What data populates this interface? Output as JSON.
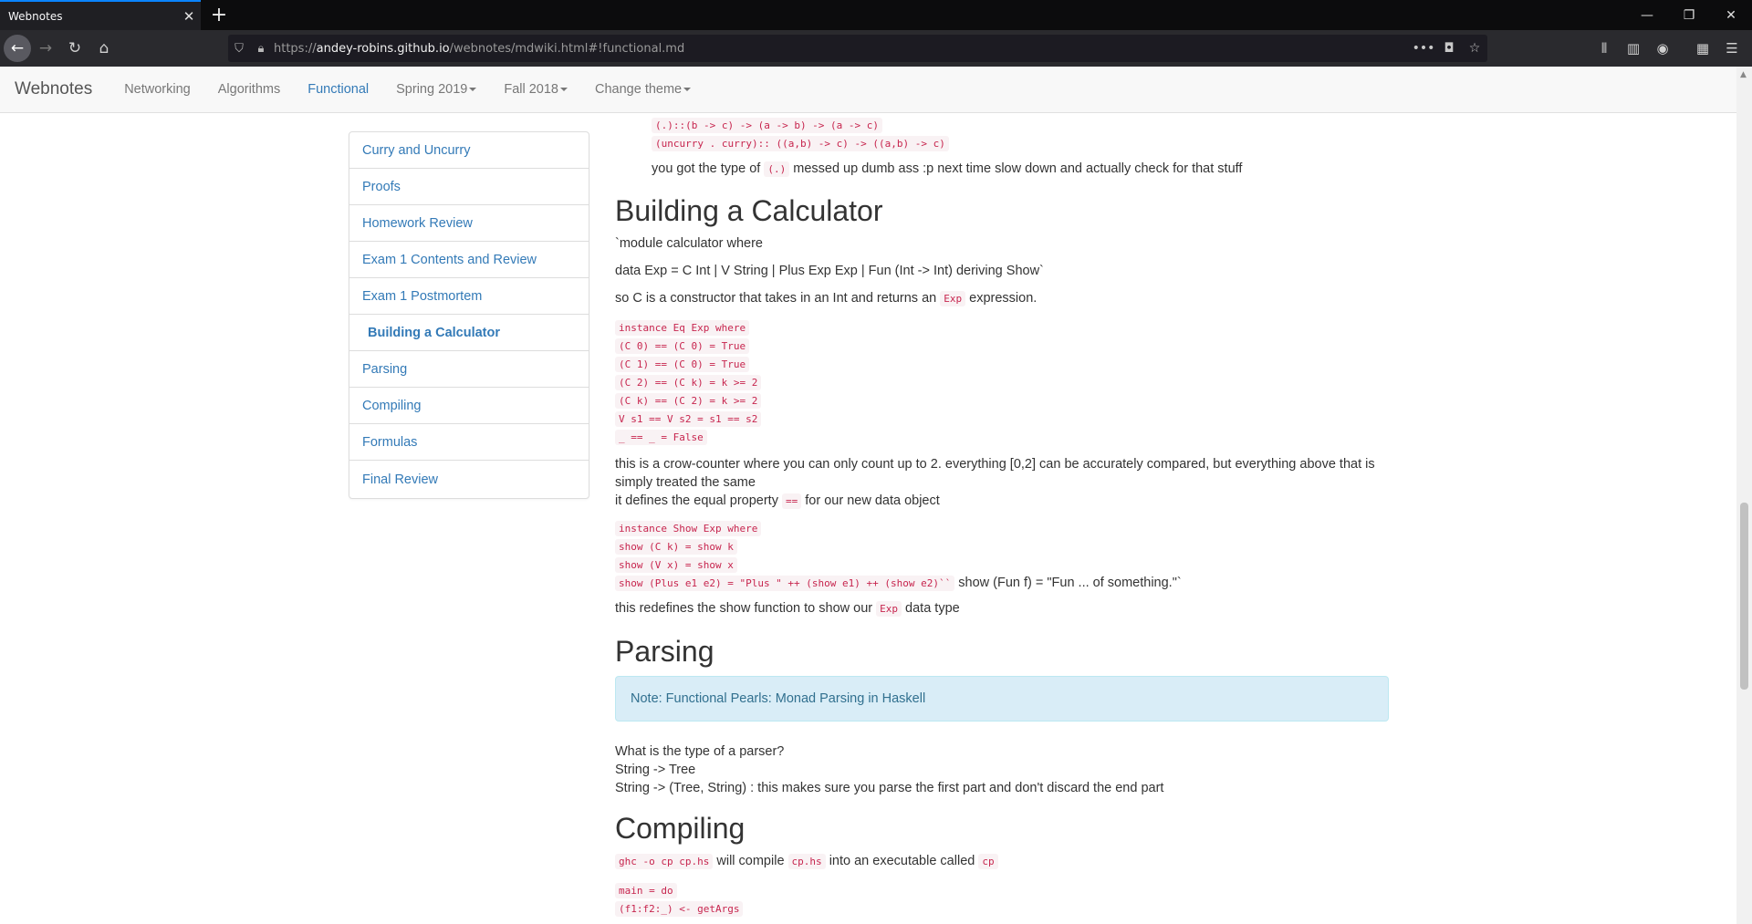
{
  "browser": {
    "tab_title": "Webnotes",
    "url_prefix": "https://",
    "url_host": "andey-robins.github.io",
    "url_path": "/webnotes/mdwiki.html#!functional.md"
  },
  "navbar": {
    "brand": "Webnotes",
    "links": [
      {
        "label": "Networking"
      },
      {
        "label": "Algorithms"
      },
      {
        "label": "Functional"
      },
      {
        "label": "Spring 2019"
      },
      {
        "label": "Fall 2018"
      },
      {
        "label": "Change theme"
      }
    ]
  },
  "sidebar": {
    "items": [
      {
        "label": "Curry and Uncurry"
      },
      {
        "label": "Proofs"
      },
      {
        "label": "Homework Review"
      },
      {
        "label": "Exam 1 Contents and Review"
      },
      {
        "label": "Exam 1 Postmortem"
      },
      {
        "label": "Building a Calculator"
      },
      {
        "label": "Parsing"
      },
      {
        "label": "Compiling"
      },
      {
        "label": "Formulas"
      },
      {
        "label": "Final Review"
      }
    ]
  },
  "content": {
    "top_code": [
      "(.)::(b -> c) -> (a -> b) -> (a -> c)",
      "(uncurry . curry):: ((a,b) -> c) -> ((a,b) -> c)"
    ],
    "top_note": {
      "pre": "you got the type of",
      "code": "(.)",
      "post": "messed up dumb ass :p next time slow down and actually check for that stuff"
    },
    "calc": {
      "heading": "Building a Calculator",
      "p1": "`module calculator where",
      "p2": "data Exp = C Int | V String | Plus Exp Exp | Fun (Int -> Int) deriving Show`",
      "p3": {
        "pre": "so C is a constructor that takes in an Int and returns an",
        "code": "Exp",
        "post": "expression."
      },
      "eq_code": [
        "instance Eq Exp where",
        "(C 0) == (C 0) = True",
        "(C 1) == (C 0) = True",
        "(C 2) == (C k) = k >= 2",
        "(C k) == (C 2) = k >= 2",
        "V s1 == V s2 = s1 == s2",
        "_ == _ = False"
      ],
      "p4_line1": "this is a crow-counter where you can only count up to 2. everything [0,2] can be accurately compared, but everything above that is",
      "p4_line2": "simply treated the same",
      "p5": {
        "pre": "it defines the equal property",
        "code": "==",
        "post": "for our new data object"
      },
      "show_code": [
        "instance Show Exp where",
        "show (C k) = show k",
        "show (V x) = show x",
        "show (Plus e1 e2) = \"Plus \" ++ (show e1) ++ (show e2)``"
      ],
      "show_tail": "show (Fun f) = \"Fun ... of something.\"`",
      "p6": {
        "pre": "this redefines the show function to show our",
        "code": "Exp",
        "post": "data type"
      }
    },
    "parsing": {
      "heading": "Parsing",
      "note": "Note: Functional Pearls: Monad Parsing in Haskell",
      "lines": [
        "What is the type of a parser?",
        "String -> Tree",
        "String -> (Tree, String) : this makes sure you parse the first part and don't discard the end part"
      ]
    },
    "compiling": {
      "heading": "Compiling",
      "p1": {
        "code1": "ghc -o cp cp.hs",
        "mid1": "will compile",
        "code2": "cp.hs",
        "mid2": "into an executable called",
        "code3": "cp"
      },
      "code": [
        "main = do",
        "(f1:f2:_) <- getArgs"
      ]
    }
  }
}
